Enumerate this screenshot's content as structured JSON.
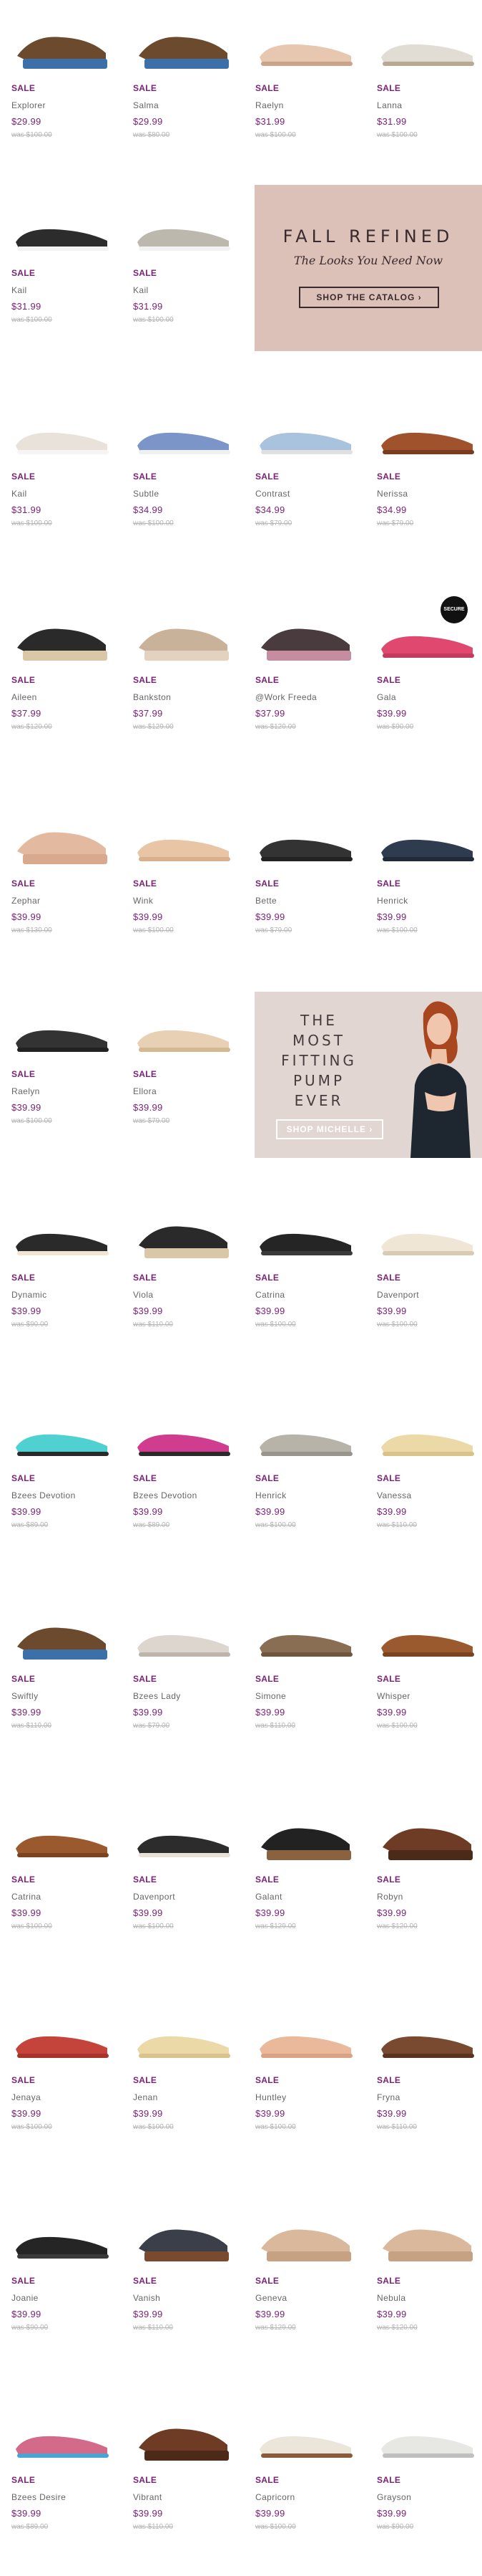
{
  "sale_label": "SALE",
  "row1": [
    {
      "name": "Explorer",
      "price": "$29.99",
      "was": "was $100.00",
      "style": "wedge-sandal"
    },
    {
      "name": "Salma",
      "price": "$29.99",
      "was": "was $80.00",
      "style": "wedge-sandal"
    },
    {
      "name": "Raelyn",
      "price": "$31.99",
      "was": "was $100.00",
      "style": "flat"
    },
    {
      "name": "Lanna",
      "price": "$31.99",
      "was": "was $100.00",
      "style": "flat-sandal"
    }
  ],
  "row2": [
    {
      "name": "Kail",
      "price": "$31.99",
      "was": "was $100.00",
      "style": "slip-on-dark"
    },
    {
      "name": "Kail",
      "price": "$31.99",
      "was": "was $100.00",
      "style": "slip-on-gray"
    }
  ],
  "promo1": {
    "title": "FALL REFINED",
    "subtitle": "The Looks You Need Now",
    "button": "SHOP THE CATALOG ›"
  },
  "row3": [
    {
      "name": "Kail",
      "price": "$31.99",
      "was": "was $100.00",
      "style": "slip-on-light"
    },
    {
      "name": "Subtle",
      "price": "$34.99",
      "was": "was $100.00",
      "style": "sneaker-blue"
    },
    {
      "name": "Contrast",
      "price": "$34.99",
      "was": "was $79.00",
      "style": "flat-blue"
    },
    {
      "name": "Nerissa",
      "price": "$34.99",
      "was": "was $79.00",
      "style": "loafer-brown"
    }
  ],
  "row4": [
    {
      "name": "Aileen",
      "price": "$37.99",
      "was": "was $120.00",
      "style": "wedge-black"
    },
    {
      "name": "Bankston",
      "price": "$37.99",
      "was": "was $129.00",
      "style": "mule-tan"
    },
    {
      "name": "@Work Freeda",
      "price": "$37.99",
      "was": "was $120.00",
      "style": "clog-print"
    },
    {
      "name": "Gala",
      "price": "$39.99",
      "was": "was $90.00",
      "style": "loafer-pink"
    }
  ],
  "row5": [
    {
      "name": "Zephar",
      "price": "$39.99",
      "was": "was $130.00",
      "style": "block-sandal"
    },
    {
      "name": "Wink",
      "price": "$39.99",
      "was": "was $100.00",
      "style": "slide-tan"
    },
    {
      "name": "Bette",
      "price": "$39.99",
      "was": "was $79.00",
      "style": "flat-black"
    },
    {
      "name": "Henrick",
      "price": "$39.99",
      "was": "was $100.00",
      "style": "loafer-navy"
    }
  ],
  "row6": [
    {
      "name": "Raelyn",
      "price": "$39.99",
      "was": "was $100.00",
      "style": "flat-black"
    },
    {
      "name": "Ellora",
      "price": "$39.99",
      "was": "was $79.00",
      "style": "sandal-beige"
    }
  ],
  "promo2": {
    "line1": "THE",
    "line2": "MOST",
    "line3": "FITTING",
    "line4": "PUMP",
    "line5": "EVER",
    "button": "SHOP MICHELLE ›"
  },
  "row7": [
    {
      "name": "Dynamic",
      "price": "$39.99",
      "was": "was $90.00",
      "style": "sport-sandal"
    },
    {
      "name": "Viola",
      "price": "$39.99",
      "was": "was $110.00",
      "style": "wedge-black"
    },
    {
      "name": "Catrina",
      "price": "$39.99",
      "was": "was $100.00",
      "style": "sandal-black"
    },
    {
      "name": "Davenport",
      "price": "$39.99",
      "was": "was $100.00",
      "style": "sneaker-cream"
    }
  ],
  "row8": [
    {
      "name": "Bzees Devotion",
      "price": "$39.99",
      "was": "was $89.00",
      "style": "knit-aqua"
    },
    {
      "name": "Bzees Devotion",
      "price": "$39.99",
      "was": "was $89.00",
      "style": "knit-pink"
    },
    {
      "name": "Henrick",
      "price": "$39.99",
      "was": "was $100.00",
      "style": "loafer-gray"
    },
    {
      "name": "Vanessa",
      "price": "$39.99",
      "was": "was $110.00",
      "style": "flat-cream"
    }
  ],
  "row9": [
    {
      "name": "Swiftly",
      "price": "$39.99",
      "was": "was $110.00",
      "style": "wedge-sandal"
    },
    {
      "name": "Bzees Lady",
      "price": "$39.99",
      "was": "was $79.00",
      "style": "mary-jane"
    },
    {
      "name": "Simone",
      "price": "$39.99",
      "was": "was $110.00",
      "style": "flat-brown"
    },
    {
      "name": "Whisper",
      "price": "$39.99",
      "was": "was $100.00",
      "style": "sandal-brown"
    }
  ],
  "row10": [
    {
      "name": "Catrina",
      "price": "$39.99",
      "was": "was $100.00",
      "style": "sandal-brown"
    },
    {
      "name": "Davenport",
      "price": "$39.99",
      "was": "was $100.00",
      "style": "sneaker-black"
    },
    {
      "name": "Galant",
      "price": "$39.99",
      "was": "was $129.00",
      "style": "clog-black"
    },
    {
      "name": "Robyn",
      "price": "$39.99",
      "was": "was $120.00",
      "style": "wedge-brown"
    }
  ],
  "row11": [
    {
      "name": "Jenaya",
      "price": "$39.99",
      "was": "was $100.00",
      "style": "sandal-red"
    },
    {
      "name": "Jenan",
      "price": "$39.99",
      "was": "was $100.00",
      "style": "flat-cream"
    },
    {
      "name": "Huntley",
      "price": "$39.99",
      "was": "was $100.00",
      "style": "flat-peach"
    },
    {
      "name": "Fryna",
      "price": "$39.99",
      "was": "was $110.00",
      "style": "slide-brown"
    }
  ],
  "row12": [
    {
      "name": "Joanie",
      "price": "$39.99",
      "was": "was $90.00",
      "style": "sandal-black"
    },
    {
      "name": "Vanish",
      "price": "$39.99",
      "was": "was $110.00",
      "style": "wedge-navy"
    },
    {
      "name": "Geneva",
      "price": "$39.99",
      "was": "was $129.00",
      "style": "heel-sandal"
    },
    {
      "name": "Nebula",
      "price": "$39.99",
      "was": "was $120.00",
      "style": "heel-sandal"
    }
  ],
  "row13": [
    {
      "name": "Bzees Desire",
      "price": "$39.99",
      "was": "was $89.00",
      "style": "knit-multi"
    },
    {
      "name": "Vibrant",
      "price": "$39.99",
      "was": "was $110.00",
      "style": "wedge-brown"
    },
    {
      "name": "Capricorn",
      "price": "$39.99",
      "was": "was $100.00",
      "style": "sandal-white"
    },
    {
      "name": "Grayson",
      "price": "$39.99",
      "was": "was $90.00",
      "style": "sneaker-white"
    }
  ],
  "fab_label": "SECURE",
  "colors": {
    "sale": "#7b1f77",
    "promo_bg": "#dcc1b8",
    "promo2_bg": "#e2d6d2"
  }
}
